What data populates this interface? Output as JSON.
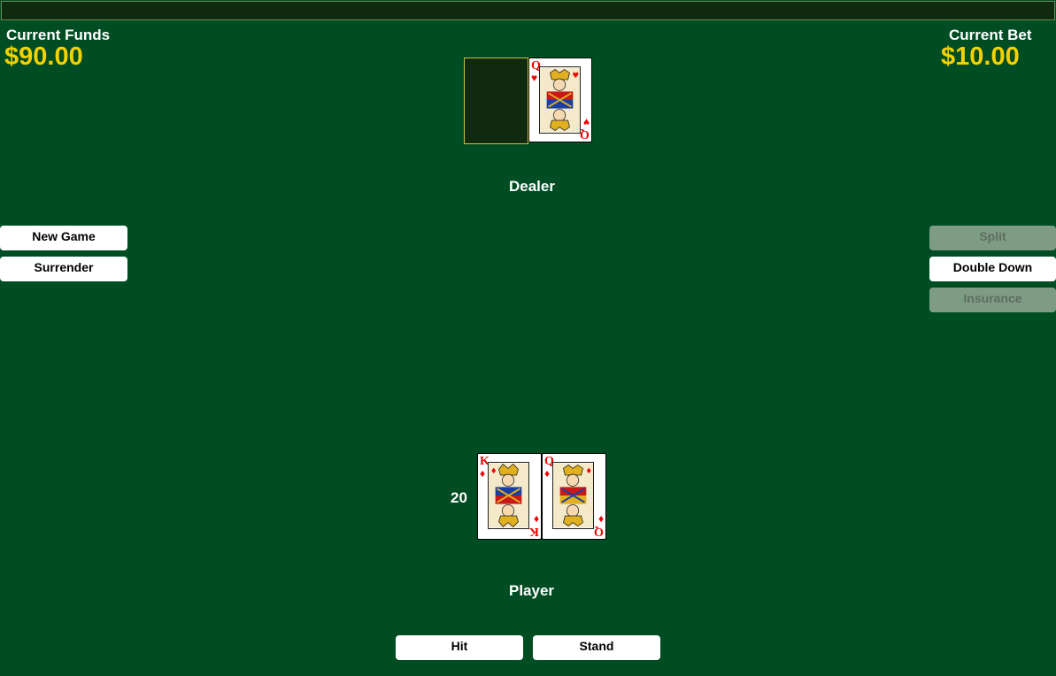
{
  "funds": {
    "label": "Current Funds",
    "value": "$90.00"
  },
  "bet": {
    "label": "Current Bet",
    "value": "$10.00"
  },
  "dealer": {
    "label": "Dealer",
    "cards": [
      {
        "face_down": true
      },
      {
        "rank": "Q",
        "suit_symbol": "♥",
        "suit": "hearts"
      }
    ]
  },
  "player": {
    "label": "Player",
    "score": "20",
    "cards": [
      {
        "rank": "K",
        "suit_symbol": "♦",
        "suit": "diamonds"
      },
      {
        "rank": "Q",
        "suit_symbol": "♦",
        "suit": "diamonds"
      }
    ]
  },
  "left_buttons": {
    "new_game": "New Game",
    "surrender": "Surrender"
  },
  "right_buttons": {
    "split": "Split",
    "double_down": "Double Down",
    "insurance": "Insurance"
  },
  "bottom_buttons": {
    "hit": "Hit",
    "stand": "Stand"
  },
  "colors": {
    "table": "#004d23",
    "money": "#f3d100",
    "card_red": "#e00000",
    "disabled_button": "#7e9c83"
  }
}
